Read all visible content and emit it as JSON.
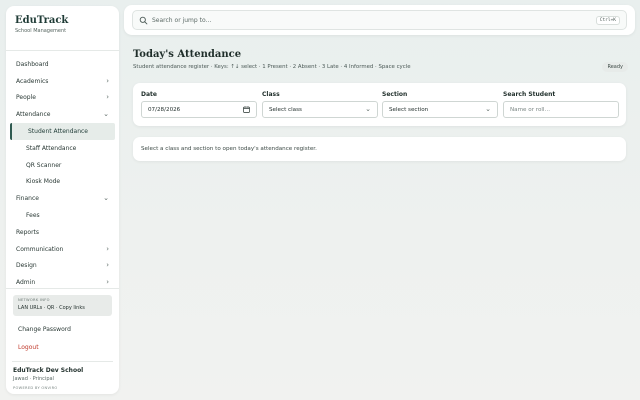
{
  "brand": {
    "title": "EduTrack",
    "subtitle": "School Management"
  },
  "nav": {
    "items": [
      {
        "label": "Dashboard",
        "chevron": ""
      },
      {
        "label": "Academics",
        "chevron": "›"
      },
      {
        "label": "People",
        "chevron": "›"
      },
      {
        "label": "Attendance",
        "chevron": "⌄"
      },
      {
        "label": "Student Attendance",
        "chevron": ""
      },
      {
        "label": "Staff Attendance",
        "chevron": ""
      },
      {
        "label": "QR Scanner",
        "chevron": ""
      },
      {
        "label": "Kiosk Mode",
        "chevron": ""
      },
      {
        "label": "Finance",
        "chevron": "⌄"
      },
      {
        "label": "Fees",
        "chevron": ""
      },
      {
        "label": "Reports",
        "chevron": ""
      },
      {
        "label": "Communication",
        "chevron": "›"
      },
      {
        "label": "Design",
        "chevron": "›"
      },
      {
        "label": "Admin",
        "chevron": "›"
      }
    ]
  },
  "network": {
    "title": "NETWORK INFO",
    "text": "LAN URLs · QR · Copy links"
  },
  "account": {
    "change_password": "Change Password",
    "logout": "Logout"
  },
  "school": {
    "name": "EduTrack Dev School",
    "user": "Jawad · Principal",
    "powered": "POWERED BY ONVIRO"
  },
  "search": {
    "placeholder": "Search or jump to…",
    "shortcut": "Ctrl+K"
  },
  "page": {
    "title": "Today's Attendance",
    "subtitle": "Student attendance register · Keys: ↑↓ select · 1 Present · 2 Absent · 3 Late · 4 Informed · Space cycle",
    "status": "Ready"
  },
  "filters": {
    "date": {
      "label": "Date",
      "value": "07/28/2026"
    },
    "class": {
      "label": "Class",
      "value": "Select class"
    },
    "section": {
      "label": "Section",
      "value": "Select section"
    },
    "search_student": {
      "label": "Search Student",
      "placeholder": "Name or roll…"
    }
  },
  "info": {
    "message": "Select a class and section to open today's attendance register."
  },
  "colors": {
    "accent": "#2f5a51",
    "logout": "#c0392b"
  }
}
